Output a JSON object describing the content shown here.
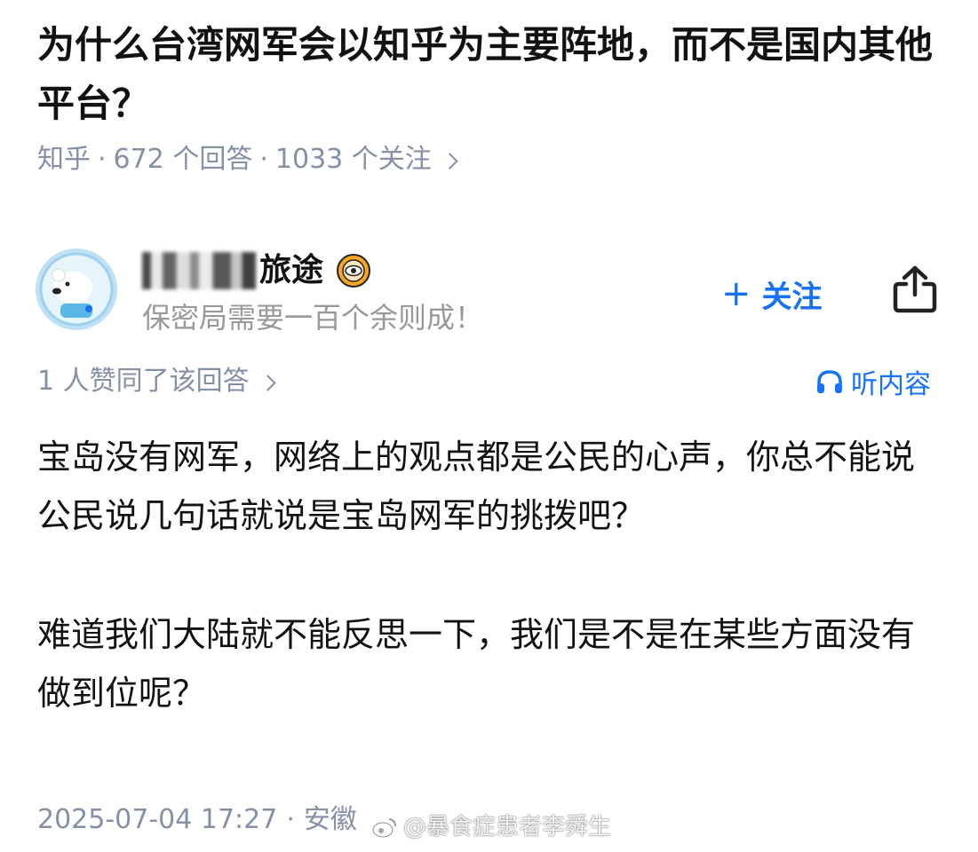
{
  "question": {
    "title": "为什么台湾网军会以知乎为主要阵地，而不是国内其他平台？",
    "source": "知乎",
    "answer_count": "672 个回答",
    "follower_count": "1033 个关注"
  },
  "author": {
    "name_suffix": "旅途",
    "bio": "保密局需要一百个余则成！",
    "badge_icon": "badge-eye-icon",
    "avatar_icon": "bear-avatar-icon"
  },
  "actions": {
    "follow_label": "关注",
    "follow_icon": "plus-icon",
    "share_icon": "share-icon",
    "listen_label": "听内容",
    "listen_icon": "headphones-icon"
  },
  "answer": {
    "voteup_text": "1 人赞同了该回答",
    "paragraphs": [
      "宝岛没有网军，网络上的观点都是公民的心声，你总不能说公民说几句话就说是宝岛网军的挑拨吧？",
      "难道我们大陆就不能反思一下，我们是不是在某些方面没有做到位呢？"
    ],
    "timestamp": "2025-07-04 17:27",
    "location": "安徽"
  },
  "watermark": {
    "text": "@暴食症患者李舜生"
  },
  "colors": {
    "accent": "#1772f6",
    "meta_gray": "#8590a6",
    "bio_gray": "#999999",
    "text": "#121212"
  }
}
